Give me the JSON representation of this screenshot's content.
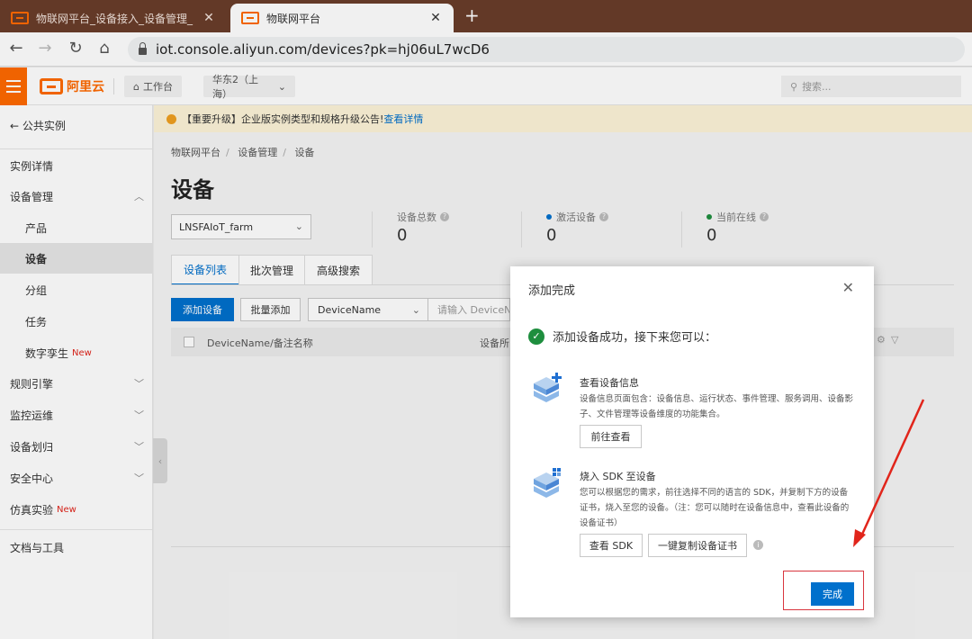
{
  "browser": {
    "tabs": [
      {
        "title": "物联网平台_设备接入_设备管理_",
        "active": false
      },
      {
        "title": "物联网平台",
        "active": true
      }
    ],
    "url": "iot.console.aliyun.com/devices?pk=hj06uL7wcD6"
  },
  "topbar": {
    "brand": "阿里云",
    "workbench": "工作台",
    "region": "华东2（上海）",
    "search_placeholder": "搜索..."
  },
  "sidebar": {
    "back": "公共实例",
    "items": [
      {
        "label": "实例详情"
      },
      {
        "label": "设备管理"
      },
      {
        "label": "产品"
      },
      {
        "label": "设备"
      },
      {
        "label": "分组"
      },
      {
        "label": "任务"
      },
      {
        "label": "数字孪生",
        "tag": "New"
      },
      {
        "label": "规则引擎"
      },
      {
        "label": "监控运维"
      },
      {
        "label": "设备划归"
      },
      {
        "label": "安全中心"
      },
      {
        "label": "仿真实验",
        "tag": "New"
      },
      {
        "label": "文档与工具"
      }
    ]
  },
  "main": {
    "notice": "【重要升级】企业版实例类型和规格升级公告!",
    "notice_link": "查看详情",
    "breadcrumb": [
      "物联网平台",
      "设备管理",
      "设备"
    ],
    "title": "设备",
    "product_select": "LNSFAIoT_farm",
    "stats": [
      {
        "label": "设备总数",
        "value": "0",
        "color": ""
      },
      {
        "label": "激活设备",
        "value": "0",
        "color": "#0070cc"
      },
      {
        "label": "当前在线",
        "value": "0",
        "color": "#1e8e3e"
      }
    ],
    "tabs": [
      "设备列表",
      "批次管理",
      "高级搜索"
    ],
    "add_device": "添加设备",
    "batch_add": "批量添加",
    "filter_field": "DeviceName",
    "filter_input": "请输入 DeviceNa",
    "columns": [
      "DeviceName/备注名称",
      "设备所"
    ]
  },
  "modal": {
    "title": "添加完成",
    "success": "添加设备成功，接下来您可以：",
    "section1": {
      "title": "查看设备信息",
      "desc": "设备信息页面包含：设备信息、运行状态、事件管理、服务调用、设备影子、文件管理等设备维度的功能集合。",
      "button": "前往查看"
    },
    "section2": {
      "title": "烧入 SDK 至设备",
      "desc": "您可以根据您的需求，前往选择不同的语言的 SDK，并复制下方的设备证书，烧入至您的设备。（注：您可以随时在设备信息中，查看此设备的设备证书）",
      "button_sdk": "查看 SDK",
      "button_copy": "一键复制设备证书"
    },
    "done": "完成"
  },
  "colors": {
    "accent": "#0070cc",
    "brand": "#ff6a00",
    "annotation": "#d9363e"
  }
}
